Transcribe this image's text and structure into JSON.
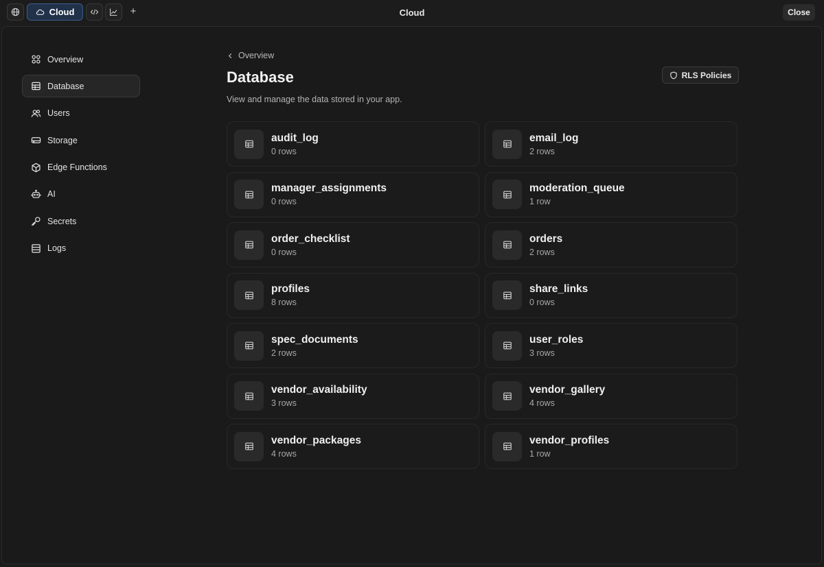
{
  "topbar": {
    "title": "Cloud",
    "cloud_tab_label": "Cloud",
    "plus_label": "+",
    "close_label": "Close"
  },
  "sidebar": {
    "items": [
      {
        "label": "Overview",
        "icon": "grid-icon",
        "active": false
      },
      {
        "label": "Database",
        "icon": "table-icon",
        "active": true
      },
      {
        "label": "Users",
        "icon": "users-icon",
        "active": false
      },
      {
        "label": "Storage",
        "icon": "storage-icon",
        "active": false
      },
      {
        "label": "Edge Functions",
        "icon": "cube-icon",
        "active": false
      },
      {
        "label": "AI",
        "icon": "robot-icon",
        "active": false
      },
      {
        "label": "Secrets",
        "icon": "key-icon",
        "active": false
      },
      {
        "label": "Logs",
        "icon": "logs-icon",
        "active": false
      }
    ]
  },
  "main": {
    "breadcrumb": "Overview",
    "title": "Database",
    "description": "View and manage the data stored in your app.",
    "rls_button": "RLS Policies",
    "tables": [
      {
        "name": "audit_log",
        "rows": "0 rows"
      },
      {
        "name": "email_log",
        "rows": "2 rows"
      },
      {
        "name": "manager_assignments",
        "rows": "0 rows"
      },
      {
        "name": "moderation_queue",
        "rows": "1 row"
      },
      {
        "name": "order_checklist",
        "rows": "0 rows"
      },
      {
        "name": "orders",
        "rows": "2 rows"
      },
      {
        "name": "profiles",
        "rows": "8 rows"
      },
      {
        "name": "share_links",
        "rows": "0 rows"
      },
      {
        "name": "spec_documents",
        "rows": "2 rows"
      },
      {
        "name": "user_roles",
        "rows": "3 rows"
      },
      {
        "name": "vendor_availability",
        "rows": "3 rows"
      },
      {
        "name": "vendor_gallery",
        "rows": "4 rows"
      },
      {
        "name": "vendor_packages",
        "rows": "4 rows"
      },
      {
        "name": "vendor_profiles",
        "rows": "1 row"
      }
    ]
  },
  "colors": {
    "background": "#1c1c1c",
    "accent_tab": "#203149",
    "accent_tab_border": "#3d5e8c"
  }
}
